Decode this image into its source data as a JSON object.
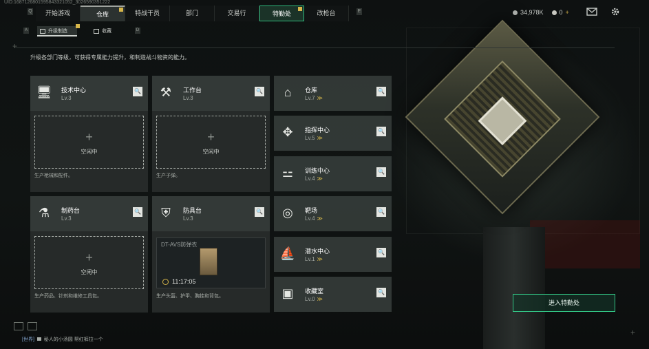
{
  "topbar": {
    "id_text": "UID:1687126801595843321052_3026590351222",
    "tabs": [
      {
        "label": "开始游戏",
        "state": "normal"
      },
      {
        "label": "仓库",
        "state": "active-gray"
      },
      {
        "label": "特战干员",
        "state": "normal"
      },
      {
        "label": "部门",
        "state": "normal"
      },
      {
        "label": "交易行",
        "state": "normal"
      },
      {
        "label": "特勤处",
        "state": "active-green"
      },
      {
        "label": "改枪台",
        "state": "normal"
      }
    ],
    "edge_left": "Q",
    "edge_right": "E",
    "currency_amount": "34,978K",
    "coupon_amount": "0",
    "coupon_plus": "+"
  },
  "subtabs": {
    "edge_left": "A",
    "edge_right": "D",
    "items": [
      "升级制造",
      "收藏"
    ]
  },
  "description": "升级各部门等级，可获得专属能力提升，和制造战斗物资的能力。",
  "labels": {
    "level_prefix": "Lv.",
    "idle": "空闲中",
    "plus": "+",
    "search": "🔍",
    "upgrade": "≫"
  },
  "workshops": [
    {
      "name": "技术中心",
      "level": "Lv.3",
      "desc": "生产枪械和配件。",
      "status": "idle"
    },
    {
      "name": "工作台",
      "level": "Lv.3",
      "desc": "生产子弹。",
      "status": "idle"
    },
    {
      "name": "制药台",
      "level": "Lv.3",
      "desc": "生产药品、针剂和维修工具包。",
      "status": "idle"
    },
    {
      "name": "防具台",
      "level": "Lv.3",
      "desc": "生产头盔、护甲、胸挂和背包。",
      "status": "crafting",
      "craft_item": "DT-AVS防弹衣",
      "timer": "11:17:05"
    }
  ],
  "facilities": [
    {
      "name": "仓库",
      "level": "Lv.7"
    },
    {
      "name": "指挥中心",
      "level": "Lv.5"
    },
    {
      "name": "训练中心",
      "level": "Lv.4"
    },
    {
      "name": "靶场",
      "level": "Lv.4"
    },
    {
      "name": "潜水中心",
      "level": "Lv.1"
    },
    {
      "name": "收藏室",
      "level": "Lv.0"
    }
  ],
  "enter_button": "进入特勤处",
  "chat": {
    "channel": "[世界]",
    "user": "秘人的小汤圆",
    "message": "帮红裤拉一个"
  },
  "colors": {
    "accent_green": "#2fbd7f",
    "badge_gold": "#d7b64a",
    "upgrade_gold": "#d8b84a"
  }
}
